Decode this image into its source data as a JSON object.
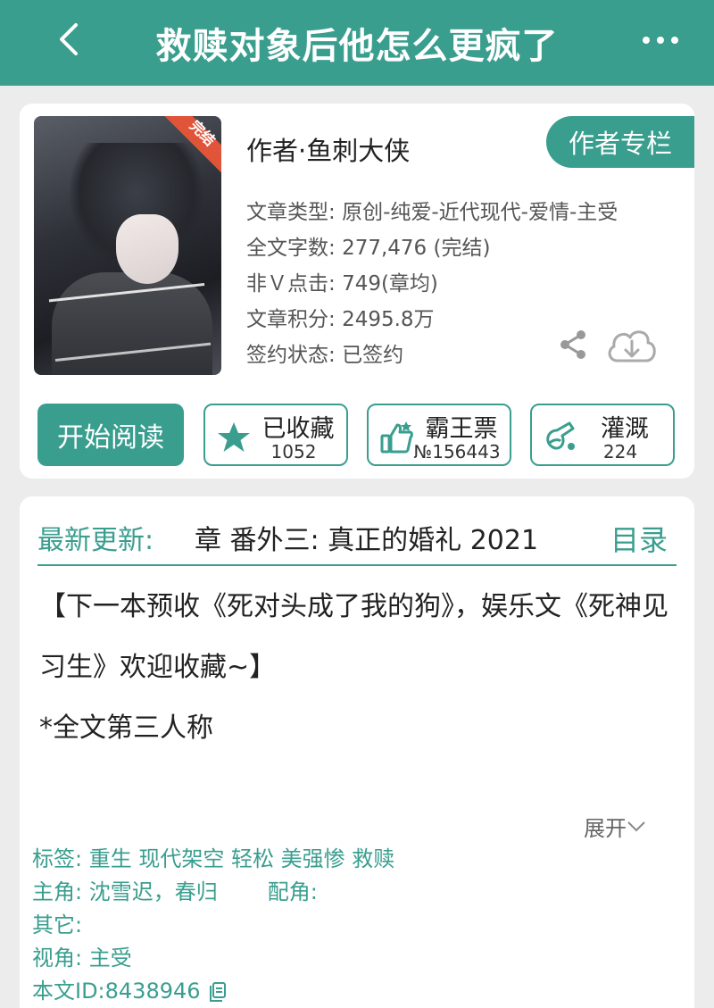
{
  "header": {
    "title": "救赎对象后他怎么更疯了",
    "back_icon": "chevron-left-icon",
    "more_icon": "more-dots-icon"
  },
  "book": {
    "cover_badge": "完结",
    "author_line": "作者·鱼刺大侠",
    "author_zone_label": "作者专栏",
    "meta": {
      "type_label": "文章类型: ",
      "type_value": "原创-纯爱-近代现代-爱情-主受",
      "words_label": "全文字数: ",
      "words_value": "277,476 (完结)",
      "clicks_label": "非Ｖ点击: ",
      "clicks_value": "749(章均)",
      "score_label": "文章积分: ",
      "score_value": "2495.8万",
      "sign_label": "签约状态: ",
      "sign_value": "已签约"
    },
    "share_icon": "share-icon",
    "download_icon": "cloud-download-icon"
  },
  "actions": {
    "read_label": "开始阅读",
    "favorite_label": "已收藏",
    "favorite_count": "1052",
    "ticket_label": "霸王票",
    "ticket_count": "№156443",
    "water_label": "灌溉",
    "water_count": "224"
  },
  "latest": {
    "label": "最新更新:",
    "value": "章  番外三: 真正的婚礼  2021",
    "toc_label": "目录"
  },
  "intro": {
    "paragraph1": "【下一本预收《死对头成了我的狗》，娱乐文《死神见习生》欢迎收藏~】",
    "paragraph2": "*全文第三人称",
    "expand_label": "展开"
  },
  "info": {
    "tags": "标签: 重生 现代架空 轻松 美强惨 救赎",
    "protagonist": "主角: 沈雪迟，春归",
    "supporting": "配角:",
    "other": "其它:",
    "perspective": "视角: 主受",
    "id": "本文ID:8438946"
  },
  "colors": {
    "accent": "#3a9e8f",
    "badge": "#e0543a"
  }
}
